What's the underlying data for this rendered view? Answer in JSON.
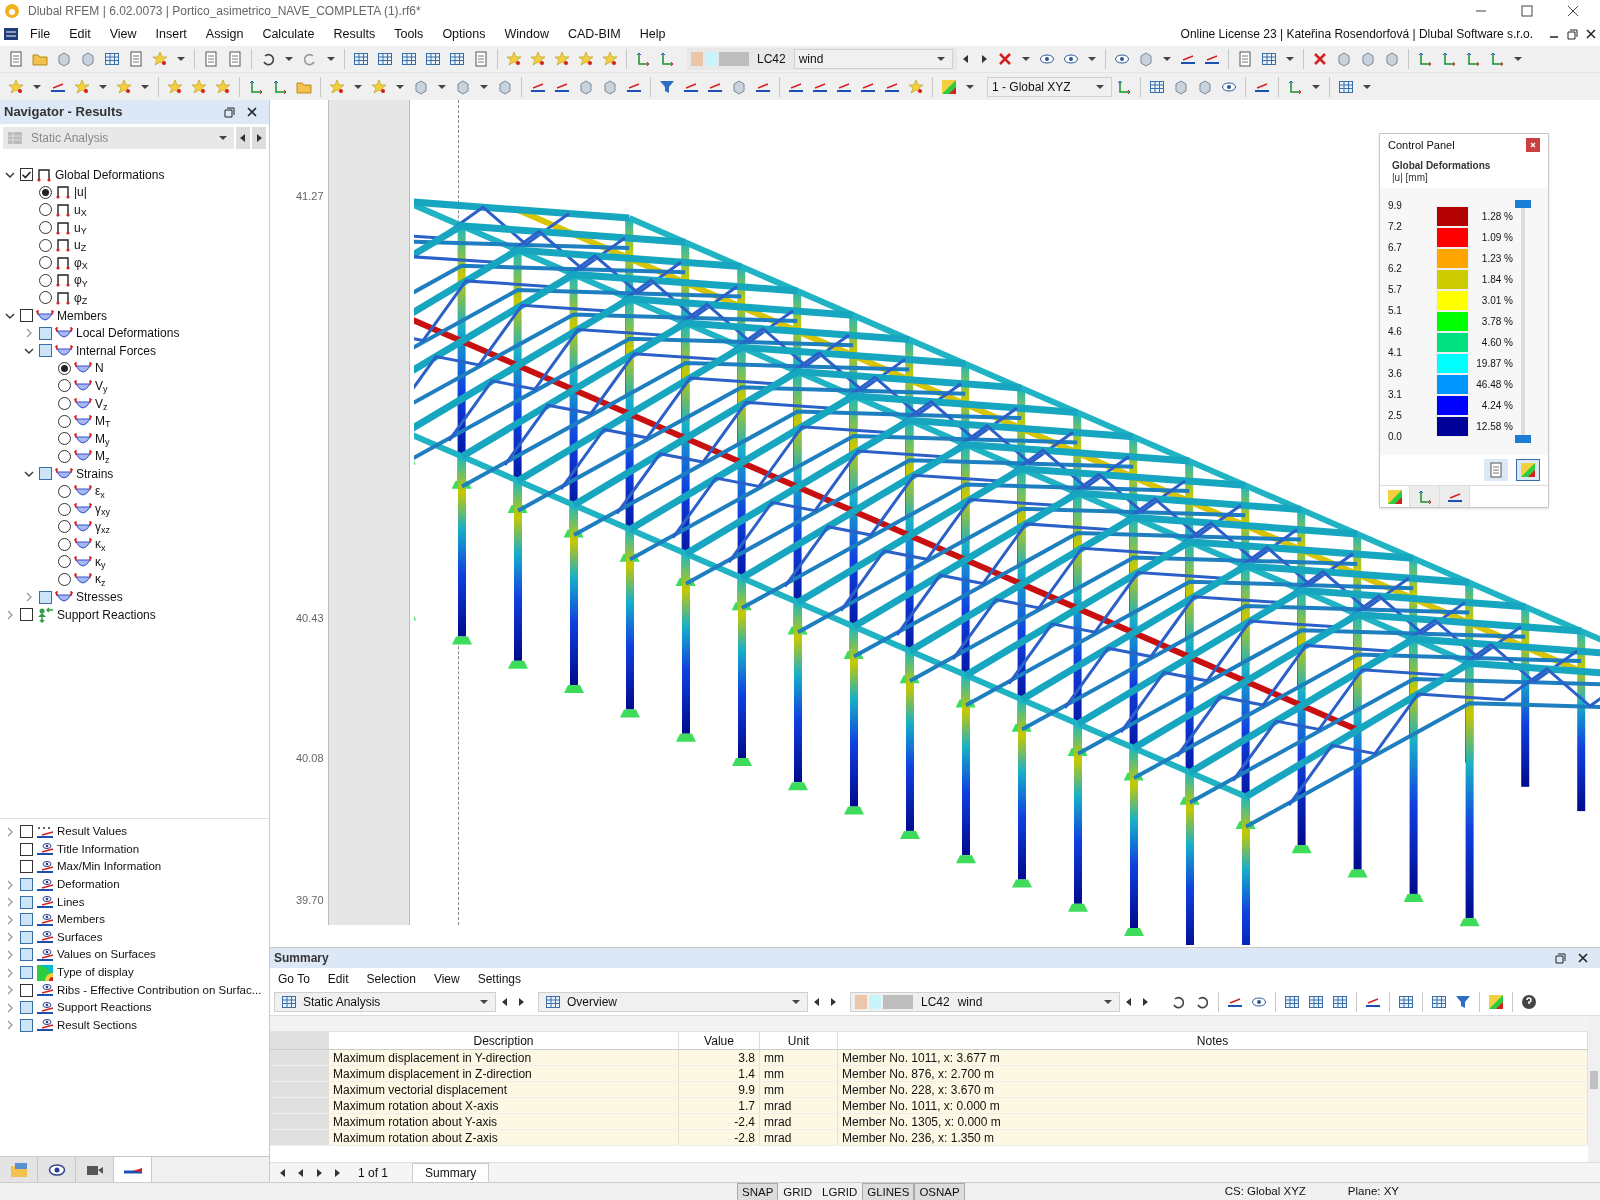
{
  "window": {
    "title": "Dlubal RFEM | 6.02.0073 | Portico_asimetrico_NAVE_COMPLETA (1).rf6*"
  },
  "menu": [
    "File",
    "Edit",
    "View",
    "Insert",
    "Assign",
    "Calculate",
    "Results",
    "Tools",
    "Options",
    "Window",
    "CAD-BIM",
    "Help"
  ],
  "license": "Online License 23 | Kateřina Rosendorfová | Dlubal Software s.r.o.",
  "toolbar": {
    "load_case": "LC42",
    "load_case_name": "wind",
    "coordinate_system": "1 - Global XYZ"
  },
  "navigator": {
    "title": "Navigator - Results",
    "dropdown": "Static Analysis",
    "tree": [
      {
        "label": "Global Deformations",
        "kind": "deformation",
        "expanded": true,
        "checked": true,
        "partial": false,
        "children": [
          {
            "label": "|u|",
            "kind": "deformation",
            "selected": true
          },
          {
            "label": "u$_{X}$",
            "kind": "deformation",
            "selected": false
          },
          {
            "label": "u$_{Y}$",
            "kind": "deformation",
            "selected": false
          },
          {
            "label": "u$_{Z}$",
            "kind": "deformation",
            "selected": false
          },
          {
            "label": "φ$_{X}$",
            "kind": "deformation",
            "selected": false
          },
          {
            "label": "φ$_{Y}$",
            "kind": "deformation",
            "selected": false
          },
          {
            "label": "φ$_{Z}$",
            "kind": "deformation",
            "selected": false
          }
        ]
      },
      {
        "label": "Members",
        "kind": "member",
        "expanded": true,
        "checked": false,
        "partial": false,
        "children": [
          {
            "label": "Local Deformations",
            "kind": "member",
            "expanded": false,
            "checked": false,
            "partial": true
          },
          {
            "label": "Internal Forces",
            "kind": "member",
            "expanded": true,
            "checked": false,
            "partial": true,
            "children": [
              {
                "label": "N",
                "kind": "member",
                "selected": true
              },
              {
                "label": "V$_{y}$",
                "kind": "member",
                "selected": false
              },
              {
                "label": "V$_{z}$",
                "kind": "member",
                "selected": false
              },
              {
                "label": "M$_{T}$",
                "kind": "member",
                "selected": false
              },
              {
                "label": "M$_{y}$",
                "kind": "member",
                "selected": false
              },
              {
                "label": "M$_{z}$",
                "kind": "member",
                "selected": false
              }
            ]
          },
          {
            "label": "Strains",
            "kind": "member",
            "expanded": true,
            "checked": false,
            "partial": true,
            "children": [
              {
                "label": "ε$_{x}$",
                "kind": "member",
                "selected": false
              },
              {
                "label": "γ$_{xy}$",
                "kind": "member",
                "selected": false
              },
              {
                "label": "γ$_{xz}$",
                "kind": "member",
                "selected": false
              },
              {
                "label": "κ$_{x}$",
                "kind": "member",
                "selected": false
              },
              {
                "label": "κ$_{y}$",
                "kind": "member",
                "selected": false
              },
              {
                "label": "κ$_{z}$",
                "kind": "member",
                "selected": false
              }
            ]
          },
          {
            "label": "Stresses",
            "kind": "member",
            "expanded": false,
            "checked": false,
            "partial": true
          }
        ]
      },
      {
        "label": "Support Reactions",
        "kind": "support",
        "expanded": false,
        "checked": false,
        "partial": false
      }
    ],
    "display_tree": [
      {
        "label": "Result Values",
        "kind": "values",
        "expanded": false,
        "checked": false,
        "partial": false
      },
      {
        "label": "Title Information",
        "kind": "display",
        "checked": false,
        "partial": false
      },
      {
        "label": "Max/Min Information",
        "kind": "display",
        "checked": false,
        "partial": false
      },
      {
        "label": "Deformation",
        "kind": "display",
        "expanded": false,
        "checked": false,
        "partial": true
      },
      {
        "label": "Lines",
        "kind": "display",
        "expanded": false,
        "checked": false,
        "partial": true
      },
      {
        "label": "Members",
        "kind": "display",
        "expanded": false,
        "checked": false,
        "partial": true
      },
      {
        "label": "Surfaces",
        "kind": "display",
        "expanded": false,
        "checked": false,
        "partial": true
      },
      {
        "label": "Values on Surfaces",
        "kind": "display",
        "expanded": false,
        "checked": false,
        "partial": true
      },
      {
        "label": "Type of display",
        "kind": "colormap",
        "expanded": false,
        "checked": false,
        "partial": true
      },
      {
        "label": "Ribs - Effective Contribution on Surfac...",
        "kind": "display",
        "expanded": false,
        "checked": false,
        "partial": false
      },
      {
        "label": "Support Reactions",
        "kind": "display",
        "expanded": false,
        "checked": false,
        "partial": true
      },
      {
        "label": "Result Sections",
        "kind": "display",
        "expanded": false,
        "checked": false,
        "partial": true
      }
    ],
    "tabs": [
      {
        "kind": "data",
        "selected": false
      },
      {
        "kind": "view",
        "selected": false
      },
      {
        "kind": "camera",
        "selected": false
      },
      {
        "kind": "results",
        "selected": true
      }
    ]
  },
  "viewport": {
    "ruler_labels": [
      "41.27",
      "40.43",
      "40.08",
      "39.70"
    ]
  },
  "control_panel": {
    "title": "Control Panel",
    "heading": "Global Deformations",
    "subheading": "|u| [mm]",
    "ticks": [
      "9.9",
      "7.2",
      "6.7",
      "6.2",
      "5.7",
      "5.1",
      "4.6",
      "4.1",
      "3.6",
      "3.1",
      "2.5",
      "0.0"
    ],
    "bands": [
      {
        "color": "#b30000",
        "percent": "1.28 %"
      },
      {
        "color": "#ff0000",
        "percent": "1.09 %"
      },
      {
        "color": "#ffa500",
        "percent": "1.23 %"
      },
      {
        "color": "#cccc00",
        "percent": "1.84 %"
      },
      {
        "color": "#ffff00",
        "percent": "3.01 %"
      },
      {
        "color": "#00ff00",
        "percent": "3.78 %"
      },
      {
        "color": "#00e080",
        "percent": "4.60 %"
      },
      {
        "color": "#00ffff",
        "percent": "19.87 %"
      },
      {
        "color": "#0096ff",
        "percent": "46.48 %"
      },
      {
        "color": "#0000ff",
        "percent": "4.24 %"
      },
      {
        "color": "#000099",
        "percent": "12.58 %"
      }
    ],
    "range_handles": [
      {
        "level": 1
      },
      {
        "level": 0
      }
    ],
    "tabs": [
      {
        "kind": "scale",
        "selected": true
      },
      {
        "kind": "balance",
        "selected": false
      },
      {
        "kind": "settings",
        "selected": false
      }
    ]
  },
  "summary": {
    "title": "Summary",
    "menu": [
      "Go To",
      "Edit",
      "Selection",
      "View",
      "Settings"
    ],
    "analysis": "Static Analysis",
    "view": "Overview",
    "load_case": "LC42",
    "load_case_name": "wind",
    "columns": [
      "Description",
      "Value",
      "Unit",
      "Notes"
    ],
    "rows": [
      [
        "Maximum displacement in Y-direction",
        "3.8",
        "mm",
        "Member No. 1011, x: 3.677 m"
      ],
      [
        "Maximum displacement in Z-direction",
        "1.4",
        "mm",
        "Member No. 876, x: 2.700 m"
      ],
      [
        "Maximum vectorial displacement",
        "9.9",
        "mm",
        "Member No. 228, x: 3.670 m"
      ],
      [
        "Maximum rotation about X-axis",
        "1.7",
        "mrad",
        "Member No. 1011, x: 0.000 m"
      ],
      [
        "Maximum rotation about Y-axis",
        "-2.4",
        "mrad",
        "Member No. 1305, x: 0.000 m"
      ],
      [
        "Maximum rotation about Z-axis",
        "-2.8",
        "mrad",
        "Member No. 236, x: 1.350 m"
      ]
    ],
    "page": "1 of 1",
    "tabs": [
      {
        "label": "Summary",
        "selected": true
      }
    ]
  },
  "status_bar": {
    "toggles": [
      {
        "label": "SNAP",
        "on": true
      },
      {
        "label": "GRID",
        "on": false
      },
      {
        "label": "LGRID",
        "on": false
      },
      {
        "label": "GLINES",
        "on": true
      },
      {
        "label": "OSNAP",
        "on": true
      }
    ],
    "cs": "CS: Global XYZ",
    "plane": "Plane: XY"
  }
}
